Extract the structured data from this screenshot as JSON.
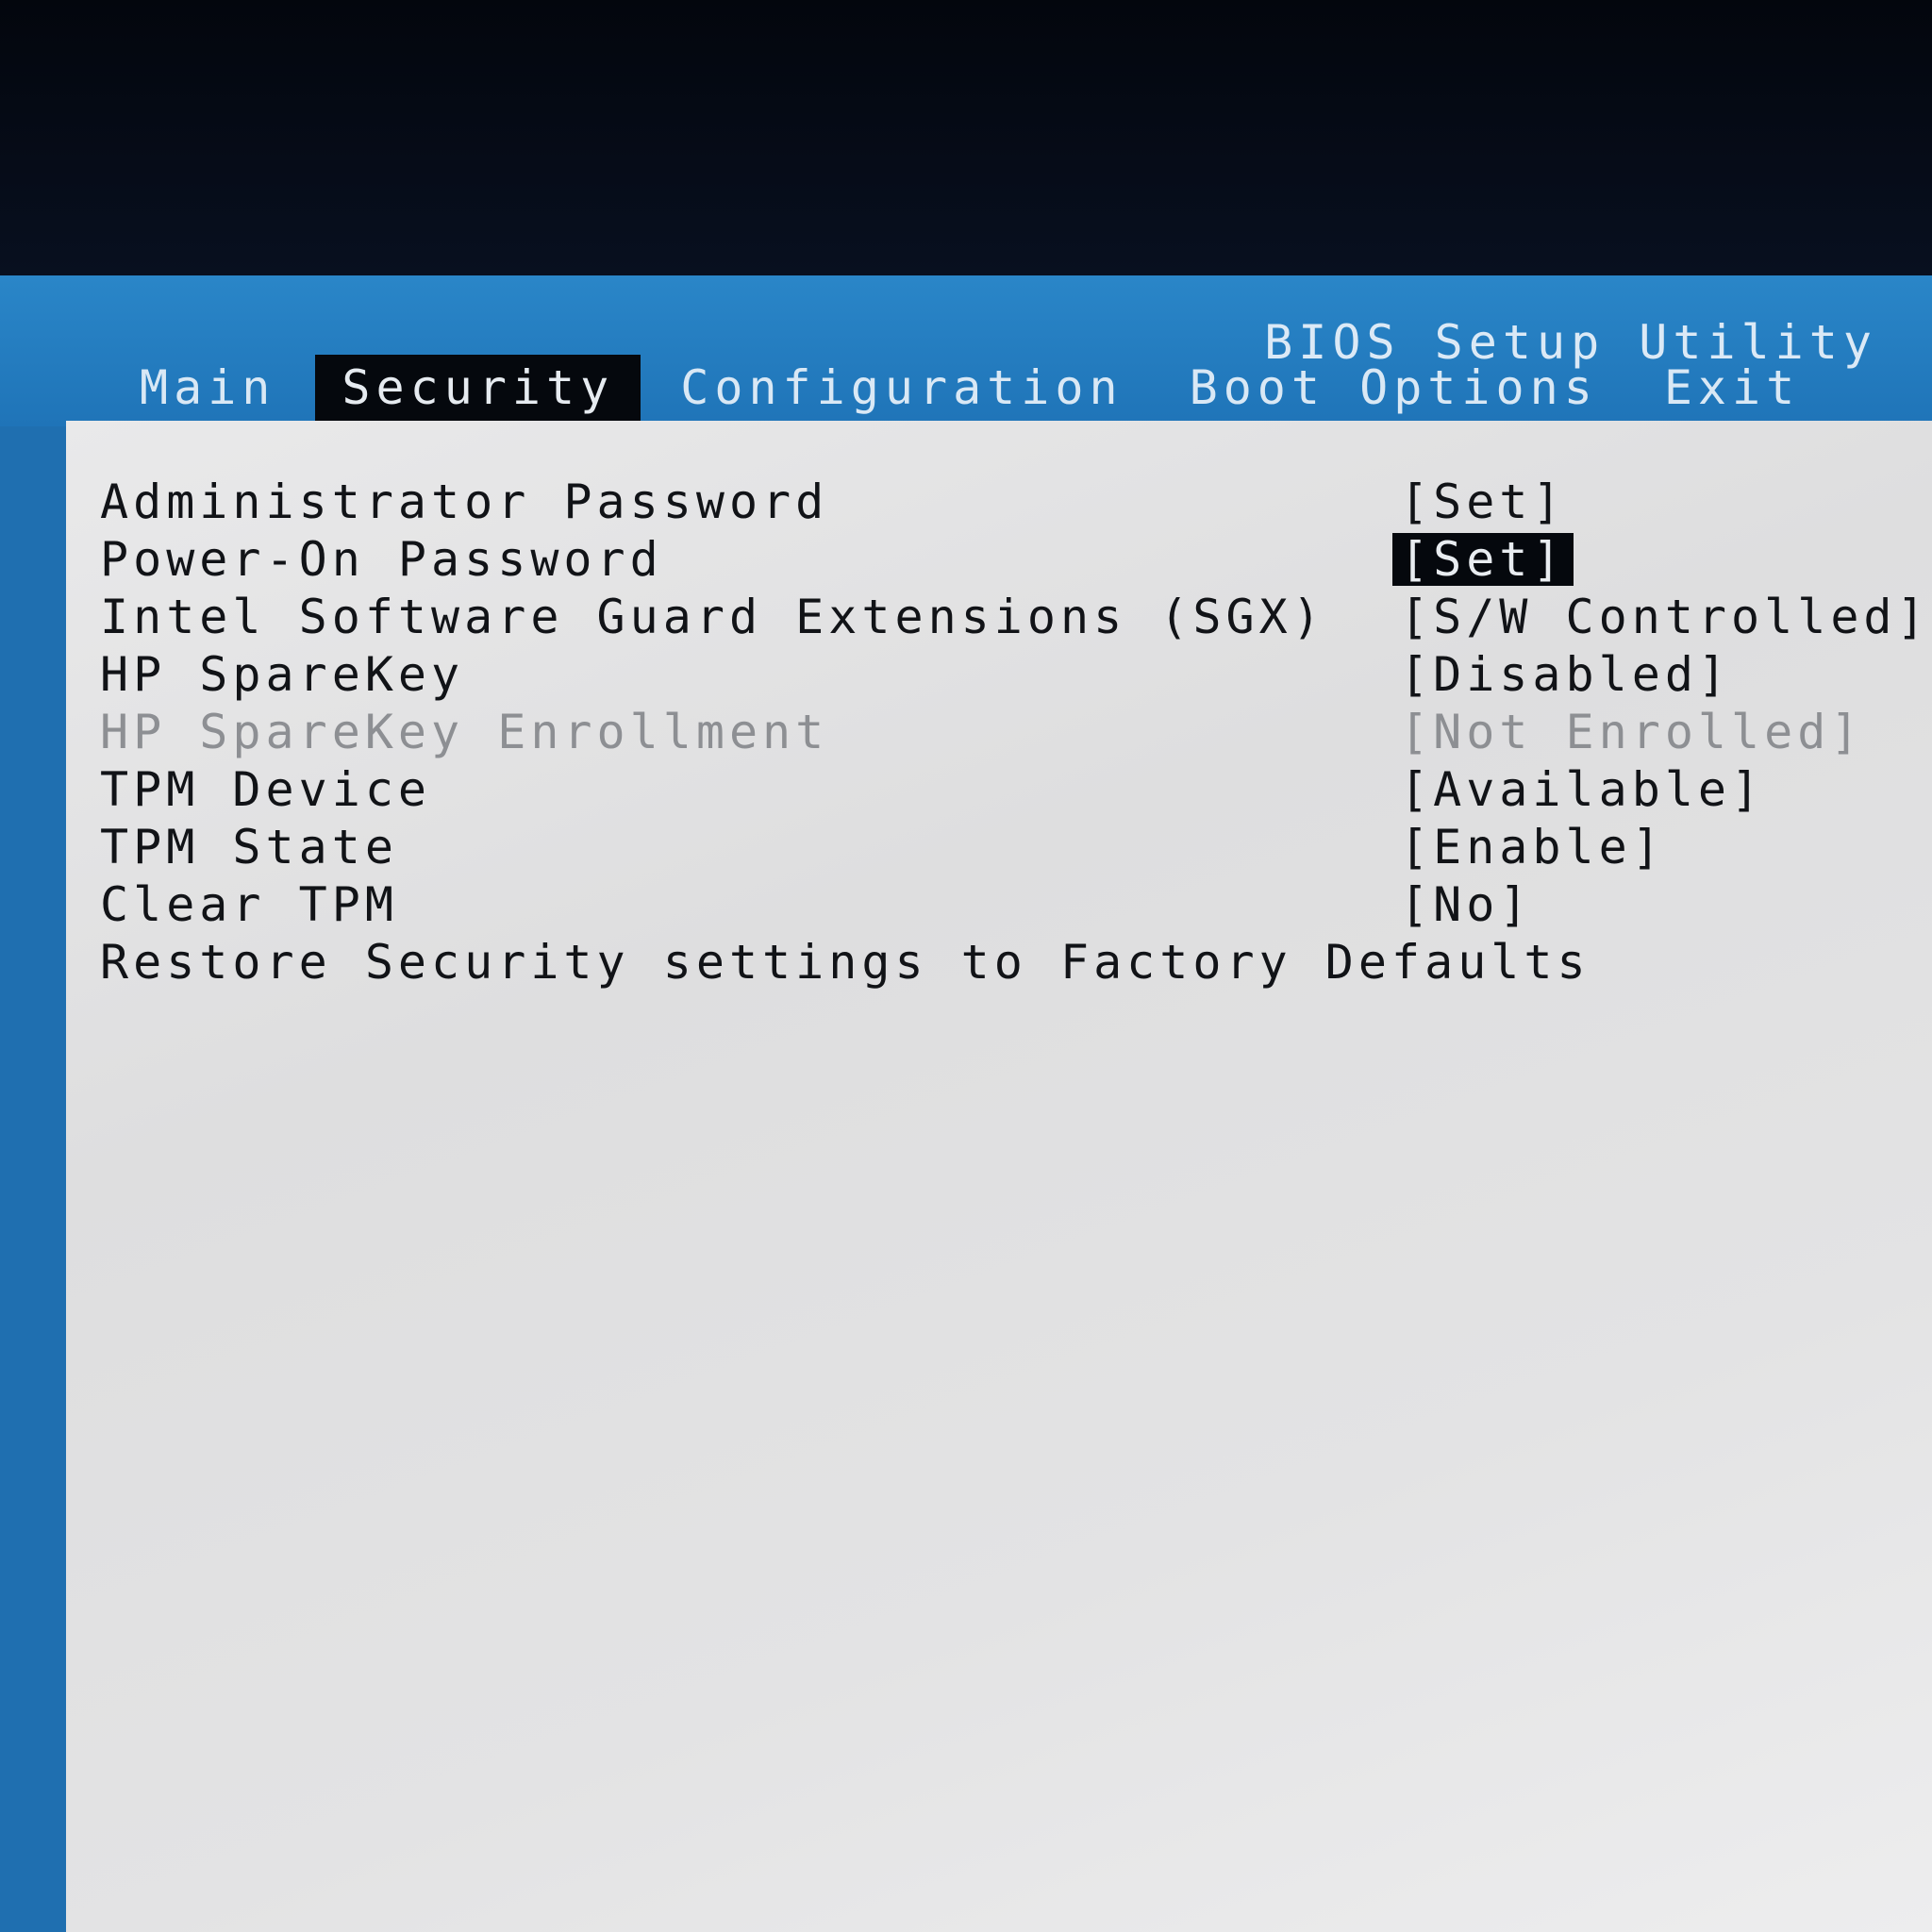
{
  "app": {
    "title": "BIOS Setup Utility"
  },
  "tabs": [
    {
      "label": "Main"
    },
    {
      "label": "Security"
    },
    {
      "label": "Configuration"
    },
    {
      "label": "Boot Options"
    },
    {
      "label": "Exit"
    }
  ],
  "active_tab": "Security",
  "security": {
    "items": [
      {
        "label": "Administrator Password",
        "value": "[Set]",
        "selected": false,
        "disabled": false
      },
      {
        "label": "Power-On Password",
        "value": "[Set]",
        "selected": true,
        "disabled": false
      },
      {
        "label": "Intel Software Guard Extensions (SGX)",
        "value": "[S/W Controlled]",
        "selected": false,
        "disabled": false
      },
      {
        "label": "HP SpareKey",
        "value": "[Disabled]",
        "selected": false,
        "disabled": false
      },
      {
        "label": "HP SpareKey Enrollment",
        "value": "[Not Enrolled]",
        "selected": false,
        "disabled": true
      },
      {
        "label": "TPM Device",
        "value": "[Available]",
        "selected": false,
        "disabled": false
      },
      {
        "label": "TPM State",
        "value": "[Enable]",
        "selected": false,
        "disabled": false
      },
      {
        "label": "Clear TPM",
        "value": "[No]",
        "selected": false,
        "disabled": false
      },
      {
        "label": "Restore Security settings to Factory Defaults",
        "value": "",
        "selected": false,
        "disabled": false
      }
    ]
  },
  "colors": {
    "header_blue": "#1f74b8",
    "highlight": "#05080d",
    "panel": "#e4e4e5",
    "disabled_text": "#8d8f93"
  }
}
